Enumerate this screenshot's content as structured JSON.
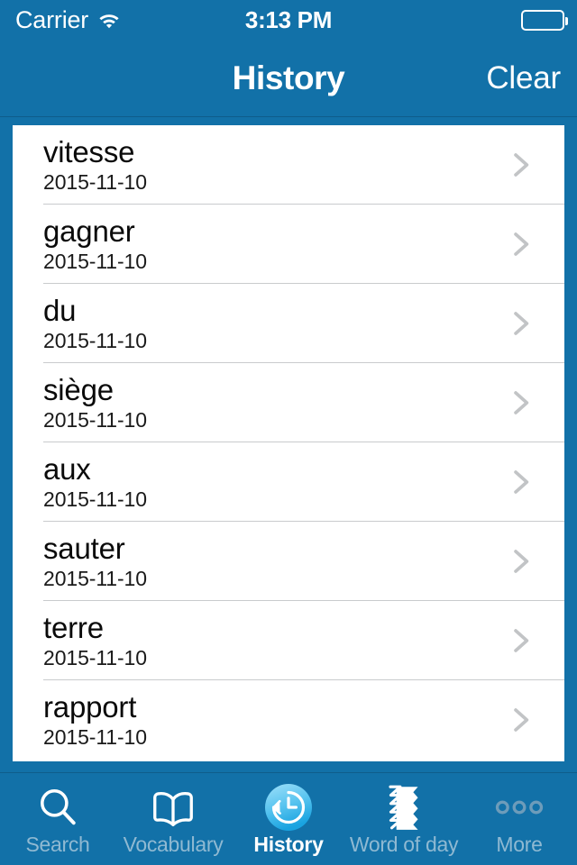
{
  "status_bar": {
    "carrier": "Carrier",
    "wifi_icon": "wifi-icon",
    "time": "3:13 PM",
    "battery_icon": "battery-icon"
  },
  "nav_bar": {
    "title": "History",
    "action_label": "Clear"
  },
  "theme": {
    "brand_blue": "#1271a8",
    "nav_divider": "#0e5d8b",
    "card_bg": "#ffffff",
    "separator": "#c9cbcd",
    "word_color": "#0a0a0a",
    "date_color": "#1a1a1a",
    "chevron_color": "#c2c4c6",
    "tab_inactive": "#8fb9d2",
    "tab_active": "#ffffff",
    "active_icon_light": "#8fd8f5",
    "active_icon_dark": "#2aa8e0"
  },
  "history": {
    "items": [
      {
        "word": "vitesse",
        "date": "2015-11-10",
        "chevron": "chevron-right-icon"
      },
      {
        "word": "gagner",
        "date": "2015-11-10",
        "chevron": "chevron-right-icon"
      },
      {
        "word": "du",
        "date": "2015-11-10",
        "chevron": "chevron-right-icon"
      },
      {
        "word": "siège",
        "date": "2015-11-10",
        "chevron": "chevron-right-icon"
      },
      {
        "word": "aux",
        "date": "2015-11-10",
        "chevron": "chevron-right-icon"
      },
      {
        "word": "sauter",
        "date": "2015-11-10",
        "chevron": "chevron-right-icon"
      },
      {
        "word": "terre",
        "date": "2015-11-10",
        "chevron": "chevron-right-icon"
      },
      {
        "word": "rapport",
        "date": "2015-11-10",
        "chevron": "chevron-right-icon"
      }
    ]
  },
  "tab_bar": {
    "tabs": [
      {
        "label": "Search",
        "icon": "magnifier-icon",
        "active": false
      },
      {
        "label": "Vocabulary",
        "icon": "open-book-icon",
        "active": false
      },
      {
        "label": "History",
        "icon": "clock-rewind-icon",
        "active": true
      },
      {
        "label": "Word of day",
        "icon": "card-stack-icon",
        "active": false
      },
      {
        "label": "More",
        "icon": "ellipsis-icon",
        "active": false
      }
    ]
  }
}
